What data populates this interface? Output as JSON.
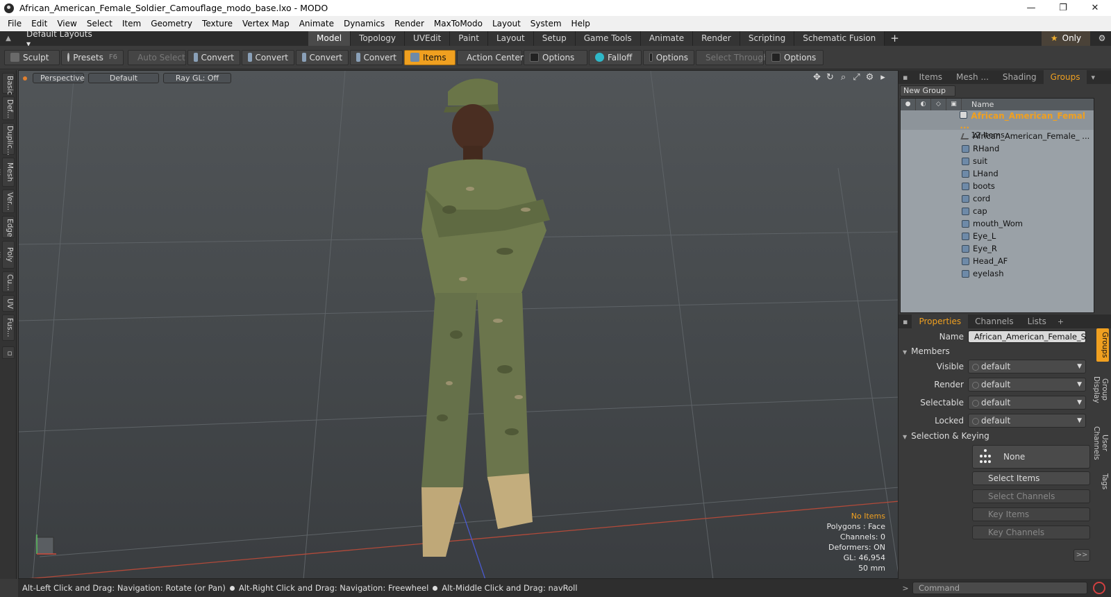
{
  "window": {
    "title": "African_American_Female_Soldier_Camouflage_modo_base.lxo - MODO",
    "minimize": "—",
    "restore": "❐",
    "close": "✕"
  },
  "menu": [
    "File",
    "Edit",
    "View",
    "Select",
    "Item",
    "Geometry",
    "Texture",
    "Vertex Map",
    "Animate",
    "Dynamics",
    "Render",
    "MaxToModo",
    "Layout",
    "System",
    "Help"
  ],
  "layout": {
    "dropdown": "Default Layouts ▾",
    "tabs": [
      "Model",
      "Topology",
      "UVEdit",
      "Paint",
      "Layout",
      "Setup",
      "Game Tools",
      "Animate",
      "Render",
      "Scripting",
      "Schematic Fusion"
    ],
    "active_tab": "Model",
    "add_tab": "+",
    "only_label": "Only",
    "star": "★"
  },
  "toolbar": {
    "sculpt": "Sculpt",
    "presets": "Presets",
    "presets_key": "F6",
    "auto_select": "Auto Select",
    "convert": "Convert",
    "items": "Items",
    "action_center": "Action Center",
    "options": "Options",
    "falloff": "Falloff",
    "select_through": "Select Through"
  },
  "left_strip": [
    "Basic",
    "Def...",
    "Duplic...",
    "Mesh ...",
    "Ver...",
    "Edge",
    "Poly ...",
    "Cu...",
    "UV",
    "Fus..."
  ],
  "viewport": {
    "view": "Perspective",
    "shading": "Default",
    "raygl": "Ray GL: Off",
    "info_status": "No Items",
    "info_lines": [
      "Polygons : Face",
      "Channels: 0",
      "Deformers: ON",
      "GL: 46,954",
      "50 mm"
    ]
  },
  "statusbar": {
    "hint1": "Alt-Left Click and Drag: Navigation: Rotate (or Pan)",
    "hint2": "Alt-Right Click and Drag: Navigation: Freewheel",
    "hint3": "Alt-Middle Click and Drag: navRoll"
  },
  "items_panel": {
    "tabs": [
      "Items",
      "Mesh ...",
      "Shading",
      "Groups"
    ],
    "active_tab": "Groups",
    "new_group": "New Group",
    "name_header": "Name",
    "group_name": "African_American_Femal ...",
    "group_count": "12 Items",
    "children": [
      "African_American_Female_ ...",
      "RHand",
      "suit",
      "LHand",
      "boots",
      "cord",
      "cap",
      "mouth_Wom",
      "Eye_L",
      "Eye_R",
      "Head_AF",
      "eyelash"
    ]
  },
  "properties": {
    "tabs": [
      "Properties",
      "Channels",
      "Lists"
    ],
    "active_tab": "Properties",
    "add": "+",
    "name_label": "Name",
    "name_value": "African_American_Female_Soldier",
    "members_section": "Members",
    "visible_label": "Visible",
    "render_label": "Render",
    "selectable_label": "Selectable",
    "locked_label": "Locked",
    "default_value": "default",
    "selection_section": "Selection & Keying",
    "none_label": "None",
    "select_items": "Select Items",
    "select_channels": "Select Channels",
    "key_items": "Key Items",
    "key_channels": "Key Channels",
    "more": ">>",
    "side_tabs": [
      "Groups",
      "Group Display",
      "User Channels",
      "Tags"
    ]
  },
  "command": {
    "prompt": ">",
    "placeholder": "Command"
  }
}
